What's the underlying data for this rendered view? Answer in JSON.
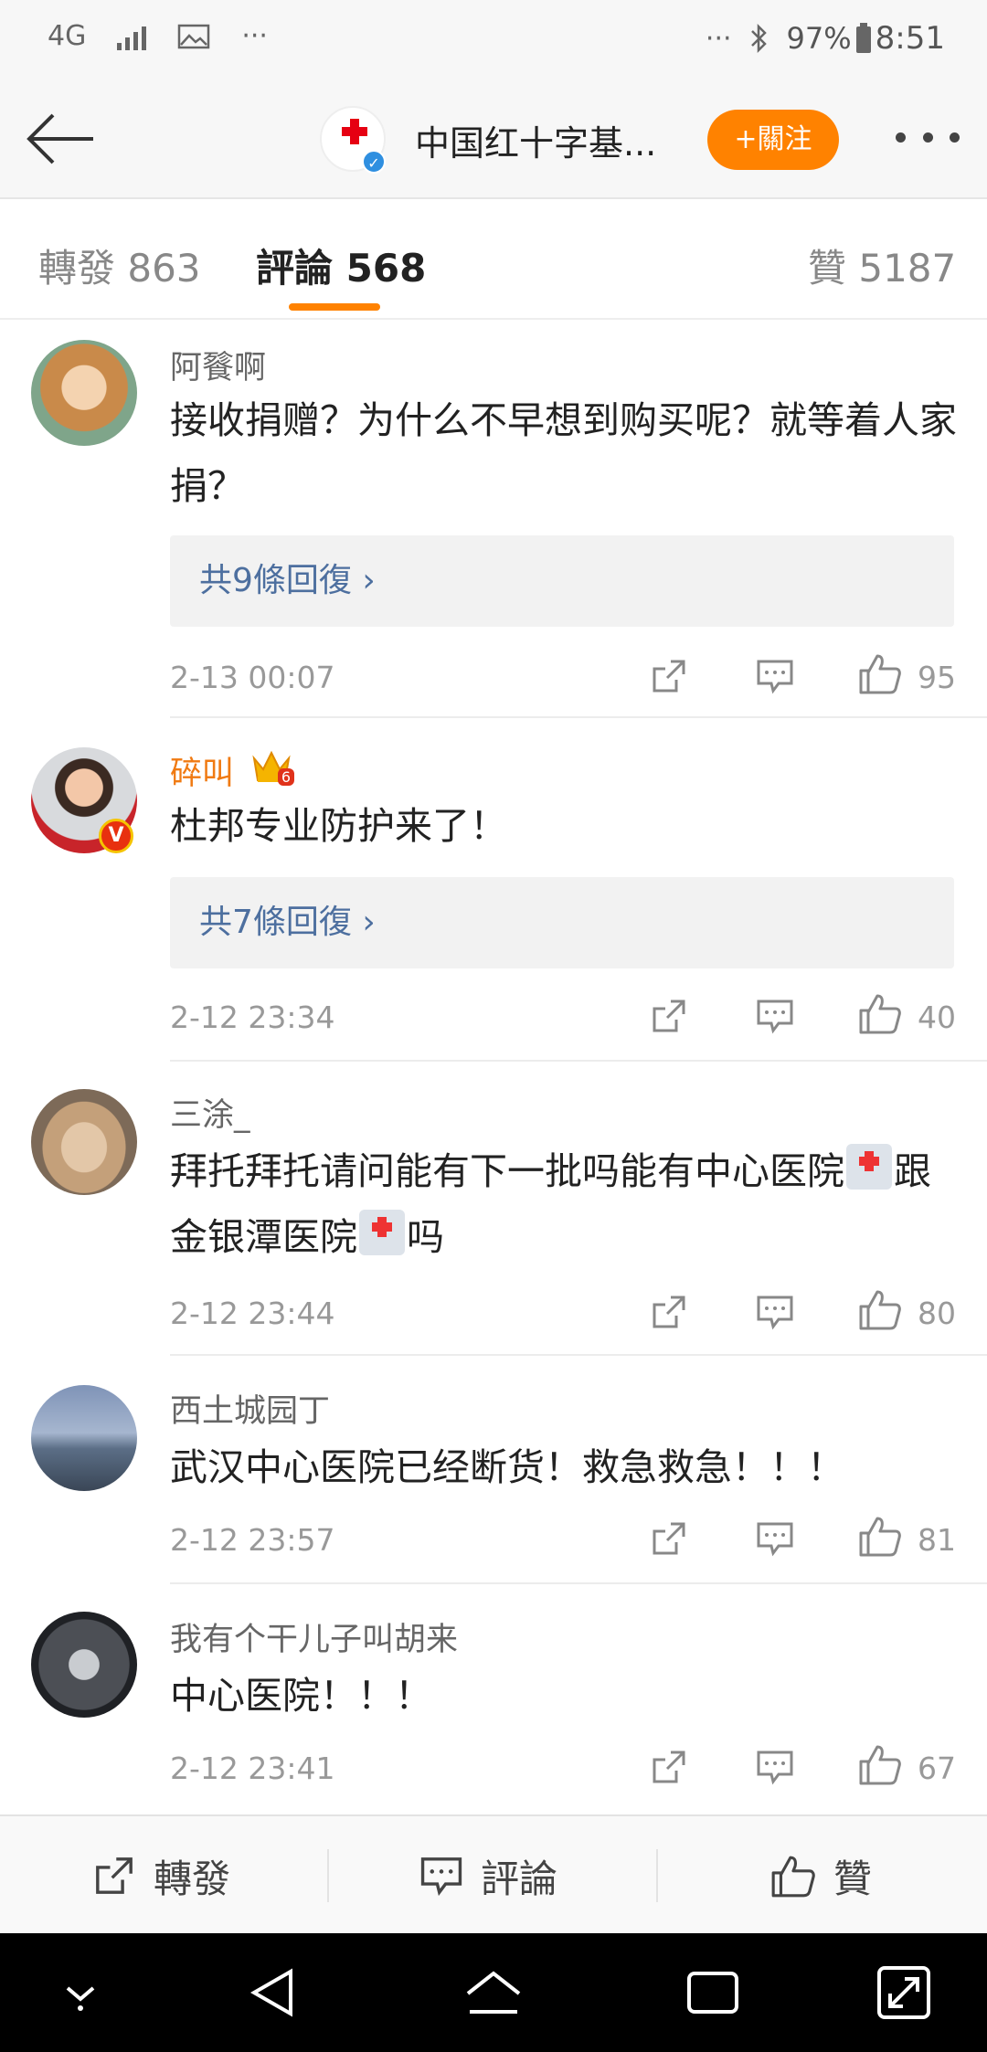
{
  "status_bar": {
    "network": "4G",
    "overflow": "···",
    "right_overflow": "···",
    "battery": "97%",
    "time": "8:51"
  },
  "header": {
    "title": "中国红十字基...",
    "follow_label": "+關注",
    "verified_mark": "✓"
  },
  "tabs": [
    {
      "label": "轉發 863"
    },
    {
      "label": "評論 568"
    },
    {
      "label": "贊 5187"
    }
  ],
  "comments": [
    {
      "username": "阿餮啊",
      "text": "接收捐赠？为什么不早想到购买呢？就等着人家捐？",
      "replies_label": "共9條回復 ›",
      "time": "2-13 00:07",
      "likes": "95"
    },
    {
      "username": "碎叫",
      "badge_level": "6",
      "verified_mark": "V",
      "text": "杜邦专业防护来了！",
      "replies_label": "共7條回復 ›",
      "time": "2-12 23:34",
      "likes": "40"
    },
    {
      "username": "三涂_",
      "text_parts": [
        "拜托拜托请问能有下一批吗能有中心医院",
        "跟金银潭医院",
        "吗"
      ],
      "time": "2-12 23:44",
      "likes": "80"
    },
    {
      "username": "西土城园丁",
      "text": "武汉中心医院已经断货！救急救急！！！",
      "time": "2-12 23:57",
      "likes": "81"
    },
    {
      "username": "我有个干儿子叫胡来",
      "text": "中心医院！！！",
      "time": "2-12 23:41",
      "likes": "67"
    }
  ],
  "bottom_bar": {
    "repost_label": "轉發",
    "comment_label": "評論",
    "like_label": "贊"
  },
  "colors": {
    "accent": "#ff8200",
    "link": "#4d6f9f",
    "verified": "#2f8fe0"
  }
}
